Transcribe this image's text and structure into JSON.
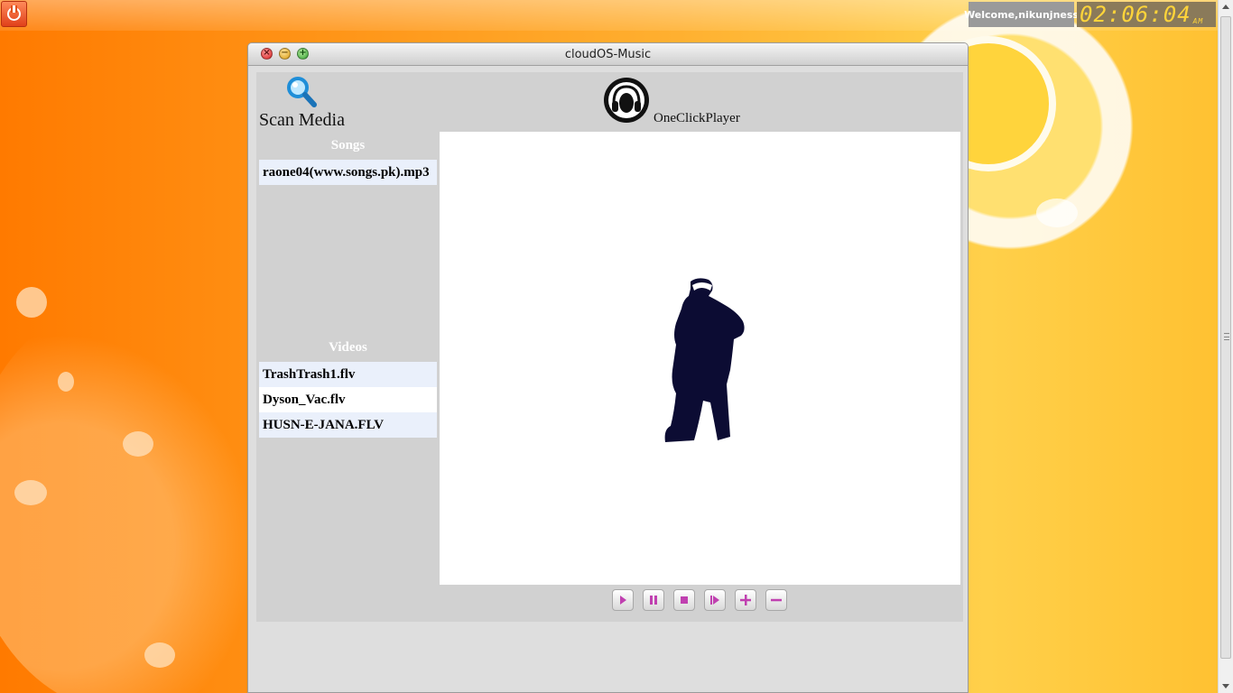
{
  "desktop": {
    "welcome_text": "Welcome,nikunjness",
    "clock_time": "02:06:04",
    "clock_ampm": "AM",
    "accent_color": "#ff7a00"
  },
  "window": {
    "title": "cloudOS-Music"
  },
  "app": {
    "scan_label": "Scan Media",
    "player_name": "OneClickPlayer",
    "songs_title": "Songs",
    "songs": [
      "raone04(www.songs.pk).mp3"
    ],
    "videos_title": "Videos",
    "videos": [
      "TrashTrash1.flv",
      "Dyson_Vac.flv",
      "HUSN-E-JANA.FLV"
    ]
  },
  "controls": {
    "icons": [
      "play-icon",
      "pause-icon",
      "stop-icon",
      "next-icon",
      "volume-up-icon",
      "volume-down-icon"
    ],
    "icon_color": "#c040b0"
  }
}
